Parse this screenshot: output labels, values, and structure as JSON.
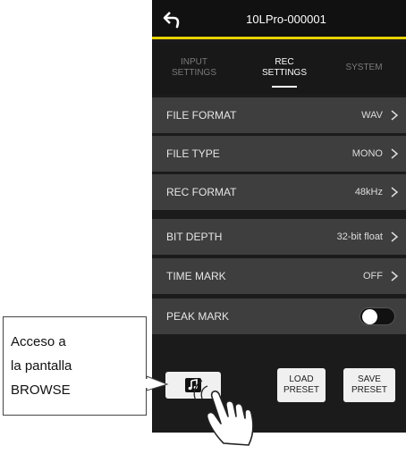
{
  "device": {
    "title": "10LPro-000001"
  },
  "tabs": [
    {
      "label": "INPUT\nSETTINGS",
      "active": false
    },
    {
      "label": "REC\nSETTINGS",
      "active": true
    },
    {
      "label": "SYSTEM",
      "active": false
    }
  ],
  "settings": [
    {
      "label": "FILE FORMAT",
      "value": "WAV"
    },
    {
      "label": "FILE TYPE",
      "value": "MONO"
    },
    {
      "label": "REC FORMAT",
      "value": "48kHz"
    },
    {
      "label": "BIT DEPTH",
      "value": "32-bit float"
    },
    {
      "label": "TIME MARK",
      "value": "OFF"
    },
    {
      "label": "PEAK MARK",
      "toggle": "off"
    }
  ],
  "buttons": {
    "load_preset": "LOAD\nPRESET",
    "save_preset": "SAVE\nPRESET",
    "browse_icon": "music-note-icon"
  },
  "callout": {
    "lines": [
      "Acceso a",
      "la pantalla",
      "BROWSE"
    ]
  },
  "colors": {
    "accent": "#e8d200",
    "background": "#1b1b1b",
    "row": "#3e3e3e"
  }
}
